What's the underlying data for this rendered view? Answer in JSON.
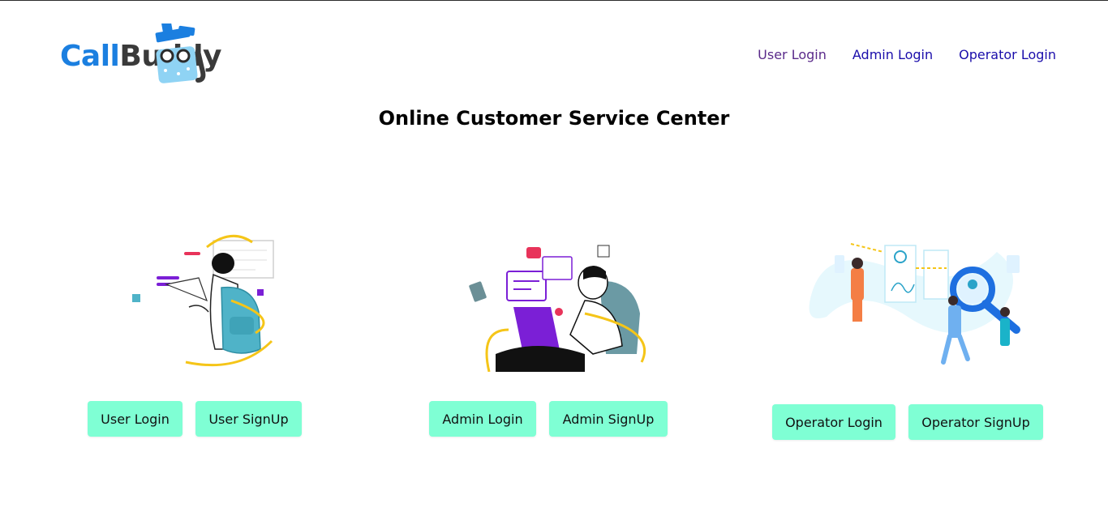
{
  "brand": {
    "part1": "Call",
    "part2": "Buddy"
  },
  "nav": {
    "user_login": "User Login",
    "admin_login": "Admin Login",
    "operator_login": "Operator Login"
  },
  "page": {
    "title": "Online Customer Service Center"
  },
  "cards": {
    "user": {
      "login": "User Login",
      "signup": "User SignUp"
    },
    "admin": {
      "login": "Admin Login",
      "signup": "Admin SignUp"
    },
    "operator": {
      "login": "Operator Login",
      "signup": "Operator SignUp"
    }
  },
  "colors": {
    "brand_blue": "#1b7fe0",
    "button_bg": "#7fffd4",
    "link": "#1a0dab",
    "visited_link": "#5a2a8a",
    "accent_purple": "#7b1fd6",
    "accent_yellow": "#f5c518",
    "accent_teal": "#4fb3c8"
  },
  "icons": {
    "logo_mascot": "shopping-bag-mascot-icon",
    "user_illustration": "student-with-backpack-illustration",
    "admin_illustration": "person-with-laptop-illustration",
    "operator_illustration": "magnifier-team-illustration"
  }
}
